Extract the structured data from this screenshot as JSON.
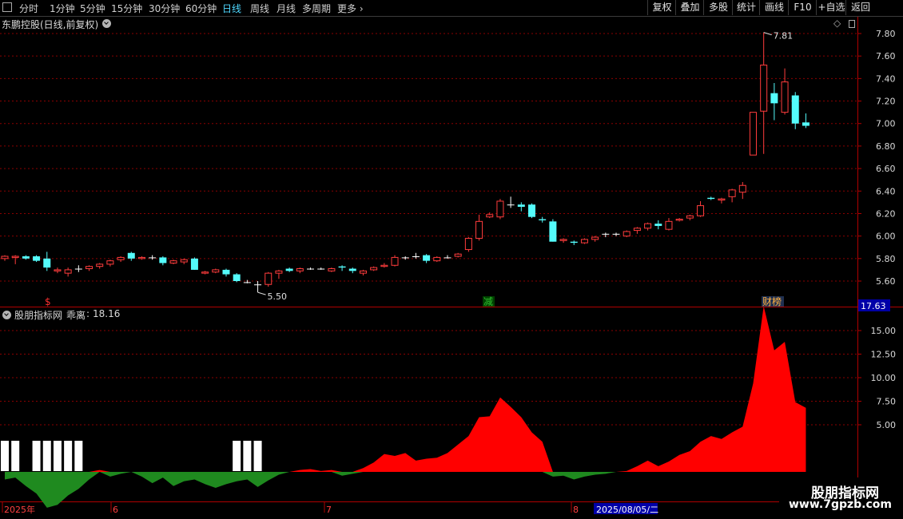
{
  "toolbar": {
    "periods": [
      "分时",
      "1分钟",
      "5分钟",
      "15分钟",
      "30分钟",
      "60分钟",
      "日线",
      "周线",
      "月线",
      "多周期",
      "更多"
    ],
    "active_period": "日线",
    "right_buttons": [
      "复权",
      "叠加",
      "多股",
      "统计",
      "画线",
      "F10",
      "+自选",
      "返回"
    ]
  },
  "main_chart": {
    "title": "东鹏控股(日线,前复权)",
    "y_ticks": [
      "7.80",
      "7.60",
      "7.40",
      "7.20",
      "7.00",
      "6.80",
      "6.60",
      "6.40",
      "6.20",
      "6.00",
      "5.80",
      "5.60"
    ],
    "ylim": [
      5.4,
      7.95
    ],
    "high_label": "7.81",
    "low_label": "5.50",
    "event_markers": [
      {
        "label": "$",
        "color": "#ff3030"
      },
      {
        "label": "减",
        "color": "#30c030"
      },
      {
        "label": "财榜",
        "color": "#ffb040"
      }
    ],
    "colors": {
      "up": "#ff3c3c",
      "down": "#54fcfc",
      "flat": "#ffffff",
      "grid": "#8b0000"
    }
  },
  "indicator": {
    "title": "股朋指标网",
    "name": "乖离",
    "value": "18.16",
    "current_tag": "17.63",
    "y_ticks": [
      "15.00",
      "12.50",
      "10.00",
      "7.50",
      "5.00"
    ]
  },
  "date_axis": {
    "labels": [
      "2025年",
      "6",
      "7",
      "8"
    ],
    "cursor_date": "2025/08/05/二"
  },
  "watermark": {
    "title": "股朋指标网",
    "url": "www.7gpzb.com"
  },
  "chart_data": {
    "type": "candlestick",
    "title": "东鹏控股(日线,前复权)",
    "candles": [
      [
        5.8,
        5.83,
        5.78,
        5.82
      ],
      [
        5.81,
        5.83,
        5.75,
        5.82
      ],
      [
        5.82,
        5.83,
        5.79,
        5.8
      ],
      [
        5.82,
        5.83,
        5.77,
        5.78
      ],
      [
        5.8,
        5.86,
        5.69,
        5.72
      ],
      [
        5.69,
        5.72,
        5.67,
        5.7
      ],
      [
        5.67,
        5.72,
        5.64,
        5.7
      ],
      [
        5.71,
        5.74,
        5.68,
        5.71
      ],
      [
        5.71,
        5.74,
        5.69,
        5.73
      ],
      [
        5.73,
        5.76,
        5.71,
        5.75
      ],
      [
        5.75,
        5.79,
        5.73,
        5.78
      ],
      [
        5.79,
        5.82,
        5.77,
        5.81
      ],
      [
        5.85,
        5.86,
        5.78,
        5.8
      ],
      [
        5.8,
        5.82,
        5.79,
        5.81
      ],
      [
        5.81,
        5.83,
        5.79,
        5.81
      ],
      [
        5.81,
        5.82,
        5.74,
        5.76
      ],
      [
        5.76,
        5.79,
        5.75,
        5.78
      ],
      [
        5.77,
        5.8,
        5.75,
        5.79
      ],
      [
        5.8,
        5.81,
        5.7,
        5.7
      ],
      [
        5.67,
        5.69,
        5.66,
        5.68
      ],
      [
        5.68,
        5.71,
        5.67,
        5.7
      ],
      [
        5.7,
        5.71,
        5.64,
        5.66
      ],
      [
        5.66,
        5.67,
        5.59,
        5.6
      ],
      [
        5.59,
        5.61,
        5.58,
        5.59
      ],
      [
        5.57,
        5.6,
        5.5,
        5.57
      ],
      [
        5.57,
        5.68,
        5.55,
        5.67
      ],
      [
        5.67,
        5.7,
        5.62,
        5.69
      ],
      [
        5.71,
        5.72,
        5.68,
        5.69
      ],
      [
        5.69,
        5.72,
        5.67,
        5.71
      ],
      [
        5.71,
        5.72,
        5.7,
        5.71
      ],
      [
        5.71,
        5.72,
        5.7,
        5.71
      ],
      [
        5.69,
        5.72,
        5.68,
        5.71
      ],
      [
        5.73,
        5.74,
        5.69,
        5.72
      ],
      [
        5.71,
        5.72,
        5.67,
        5.69
      ],
      [
        5.67,
        5.7,
        5.65,
        5.69
      ],
      [
        5.7,
        5.73,
        5.69,
        5.72
      ],
      [
        5.73,
        5.76,
        5.72,
        5.74
      ],
      [
        5.74,
        5.83,
        5.73,
        5.81
      ],
      [
        5.81,
        5.82,
        5.79,
        5.81
      ],
      [
        5.82,
        5.85,
        5.8,
        5.82
      ],
      [
        5.83,
        5.84,
        5.76,
        5.78
      ],
      [
        5.78,
        5.82,
        5.77,
        5.81
      ],
      [
        5.81,
        5.83,
        5.8,
        5.81
      ],
      [
        5.82,
        5.85,
        5.81,
        5.84
      ],
      [
        5.88,
        5.99,
        5.86,
        5.98
      ],
      [
        5.98,
        6.19,
        5.96,
        6.13
      ],
      [
        6.17,
        6.21,
        6.16,
        6.19
      ],
      [
        6.17,
        6.33,
        6.15,
        6.31
      ],
      [
        6.28,
        6.35,
        6.25,
        6.28
      ],
      [
        6.28,
        6.3,
        6.22,
        6.26
      ],
      [
        6.28,
        6.29,
        6.16,
        6.17
      ],
      [
        6.15,
        6.17,
        6.12,
        6.14
      ],
      [
        6.13,
        6.15,
        5.95,
        5.95
      ],
      [
        5.96,
        5.98,
        5.94,
        5.97
      ],
      [
        5.95,
        5.96,
        5.92,
        5.94
      ],
      [
        5.94,
        5.98,
        5.93,
        5.97
      ],
      [
        5.97,
        6.0,
        5.95,
        5.99
      ],
      [
        6.02,
        6.03,
        5.99,
        6.02
      ],
      [
        6.02,
        6.03,
        6.0,
        6.02
      ],
      [
        6.0,
        6.05,
        5.99,
        6.04
      ],
      [
        6.05,
        6.08,
        6.02,
        6.07
      ],
      [
        6.07,
        6.12,
        6.05,
        6.11
      ],
      [
        6.11,
        6.14,
        6.06,
        6.09
      ],
      [
        6.06,
        6.16,
        6.05,
        6.13
      ],
      [
        6.14,
        6.16,
        6.13,
        6.15
      ],
      [
        6.16,
        6.19,
        6.14,
        6.18
      ],
      [
        6.18,
        6.31,
        6.17,
        6.27
      ],
      [
        6.34,
        6.35,
        6.32,
        6.33
      ],
      [
        6.32,
        6.34,
        6.29,
        6.33
      ],
      [
        6.35,
        6.42,
        6.3,
        6.41
      ],
      [
        6.39,
        6.48,
        6.33,
        6.45
      ],
      [
        6.72,
        6.73,
        6.72,
        7.1
      ],
      [
        7.11,
        7.81,
        6.73,
        7.52
      ],
      [
        7.27,
        7.36,
        7.03,
        7.18
      ],
      [
        7.1,
        7.49,
        7.08,
        7.37
      ],
      [
        7.25,
        7.28,
        6.95,
        7.0
      ],
      [
        7.01,
        7.09,
        6.96,
        6.98
      ]
    ],
    "indicator_series": {
      "name": "乖离",
      "values": [
        -0.8,
        -0.6,
        -1.5,
        -2.3,
        -3.8,
        -3.5,
        -2.5,
        -1.8,
        -0.8,
        0.2,
        -0.5,
        -0.2,
        0.0,
        -0.5,
        -1.2,
        -0.6,
        -1.5,
        -1.0,
        -0.8,
        -1.3,
        -1.7,
        -1.3,
        -1.0,
        -0.8,
        -1.6,
        -0.9,
        -0.3,
        0.0,
        0.2,
        0.3,
        0.1,
        0.2,
        -0.4,
        -0.2,
        0.4,
        1.0,
        1.9,
        1.7,
        2.0,
        1.2,
        1.4,
        1.5,
        2.0,
        2.9,
        3.8,
        5.8,
        5.9,
        7.9,
        6.9,
        5.8,
        4.2,
        3.2,
        -0.5,
        -0.4,
        -0.8,
        -0.5,
        -0.3,
        -0.2,
        0.0,
        0.1,
        0.6,
        1.2,
        0.6,
        1.1,
        1.8,
        2.2,
        3.2,
        3.8,
        3.5,
        4.2,
        4.8,
        9.4,
        17.6,
        12.9,
        13.8,
        7.4,
        6.8
      ],
      "white_marker_indices": [
        0,
        1,
        3,
        4,
        5,
        6,
        7,
        22,
        23,
        24
      ]
    }
  }
}
